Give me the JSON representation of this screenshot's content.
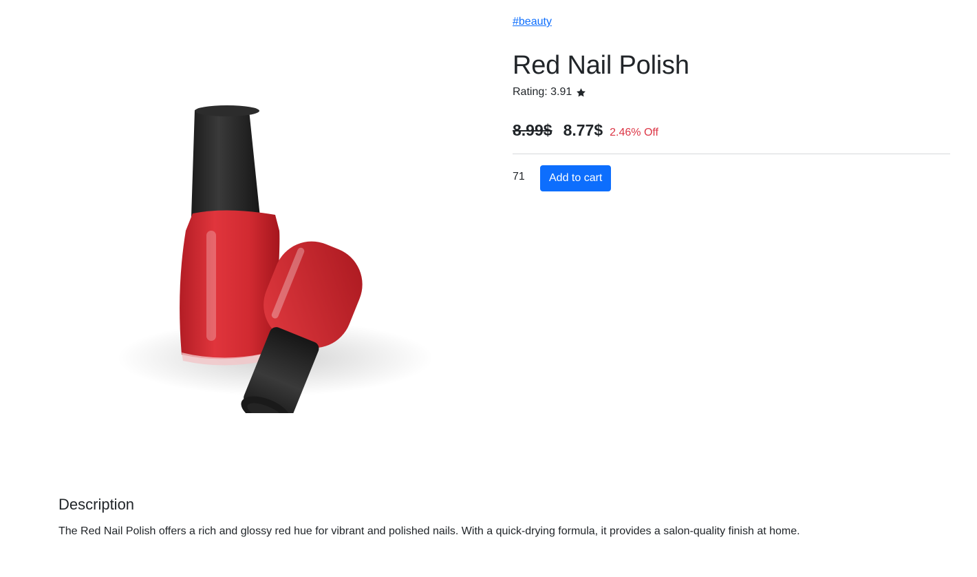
{
  "product": {
    "tag": "#beauty",
    "title": "Red Nail Polish",
    "rating_text": "Rating: 3.91",
    "rating_value": 3.91,
    "old_price": "8.99$",
    "new_price": "8.77$",
    "discount": "2.46% Off",
    "quantity": "71",
    "add_to_cart_label": "Add to cart",
    "image_alt": "Red Nail Polish",
    "image_icon": "product-photo",
    "colors": {
      "accent": "#0d6efd",
      "discount": "#dc3545",
      "polish": "#d32b33",
      "cap": "#262626"
    }
  },
  "description": {
    "heading": "Description",
    "text": "The Red Nail Polish offers a rich and glossy red hue for vibrant and polished nails. With a quick-drying formula, it provides a salon-quality finish at home."
  }
}
